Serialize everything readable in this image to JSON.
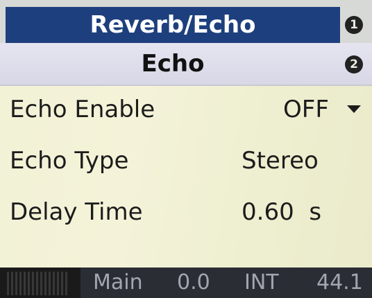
{
  "header": {
    "title": "Reverb/Echo",
    "index": "1"
  },
  "section": {
    "title": "Echo",
    "index": "2"
  },
  "params": [
    {
      "label": "Echo Enable",
      "value": "OFF",
      "dropdown_icon": "triangle-down"
    },
    {
      "label": "Echo Type",
      "value": "Stereo"
    },
    {
      "label": "Delay Time",
      "value": "0.60  s"
    }
  ],
  "status": {
    "bus": "Main",
    "gain": "0.0",
    "clock": "INT",
    "sample_rate": "44.1"
  },
  "colors": {
    "header_bg": "#1d3f7d",
    "body_bg": "#f2f2d6",
    "section_bg": "#e3e2ef"
  }
}
